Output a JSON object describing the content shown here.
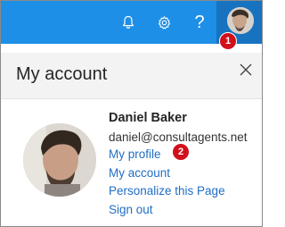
{
  "topbar": {
    "icons": [
      "bell-icon",
      "gear-icon",
      "help-icon"
    ],
    "help_glyph": "?",
    "color": "#1e8fe6"
  },
  "callouts": [
    "1",
    "2"
  ],
  "panel": {
    "title": "My account"
  },
  "user": {
    "name": "Daniel Baker",
    "email": "daniel@consultagents.net"
  },
  "links": {
    "my_profile": "My profile",
    "my_account": "My account",
    "personalize": "Personalize this Page",
    "sign_out": "Sign out"
  },
  "colors": {
    "link": "#1f6ec4",
    "callout": "#d1101b"
  }
}
